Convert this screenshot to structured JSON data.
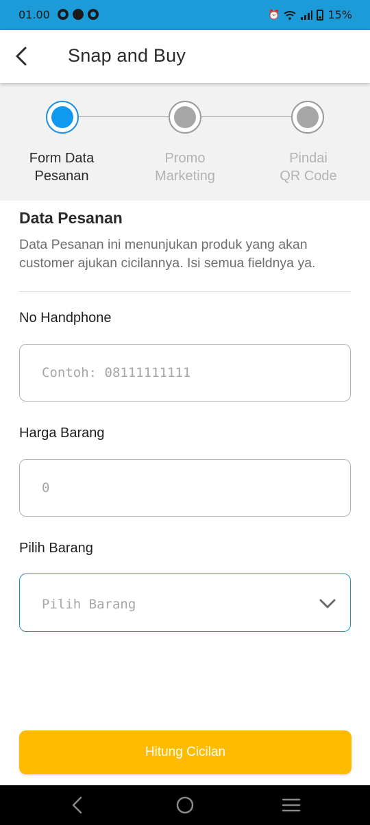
{
  "status_bar": {
    "time": "01.00",
    "battery": "15%",
    "icons": [
      "notification-dot-icon",
      "notification-dot-icon",
      "notification-dot-icon",
      "alarm-icon",
      "wifi-icon",
      "signal-icon",
      "battery-icon"
    ]
  },
  "app_bar": {
    "title": "Snap and Buy",
    "back_icon": "arrow-left-icon"
  },
  "stepper": {
    "steps": [
      {
        "label_line1": "Form Data",
        "label_line2": "Pesanan",
        "active": true
      },
      {
        "label_line1": "Promo",
        "label_line2": "Marketing",
        "active": false
      },
      {
        "label_line1": "Pindai",
        "label_line2": "QR Code",
        "active": false
      }
    ],
    "active_color": "#0f9af0",
    "inactive_color": "#a6a6a6"
  },
  "form": {
    "section_title": "Data Pesanan",
    "section_description": "Data Pesanan ini menunjukan produk yang akan customer ajukan cicilannya. Isi semua fieldnya ya.",
    "phone": {
      "label": "No Handphone",
      "placeholder": "Contoh: 08111111111",
      "value": ""
    },
    "price": {
      "label": "Harga Barang",
      "placeholder": "0",
      "value": ""
    },
    "item": {
      "label": "Pilih Barang",
      "placeholder": "Pilih Barang",
      "dropdown_icon": "chevron-down-icon"
    },
    "submit_label": "Hitung Cicilan",
    "submit_color": "#ffbb00"
  },
  "nav_bar": {
    "icons": [
      "back-icon",
      "home-icon",
      "recents-icon"
    ]
  }
}
